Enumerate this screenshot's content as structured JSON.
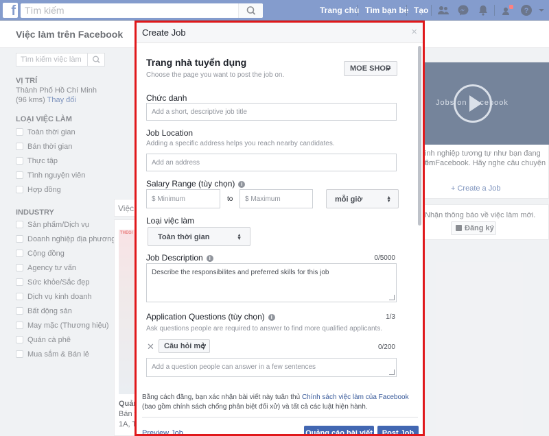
{
  "topbar": {
    "logo": "f",
    "search_placeholder": "Tìm kiếm",
    "nav": [
      "Trang chủ",
      "Tìm bạn bè",
      "Tạo"
    ],
    "icons": [
      "friends-icon",
      "messenger-icon",
      "notifications-icon",
      "menu-icon",
      "help-icon"
    ]
  },
  "subheader": {
    "title": "Việc làm trên Facebook"
  },
  "sidebar": {
    "search_placeholder": "Tìm kiếm việc làm",
    "location_heading": "VỊ TRÍ",
    "location_city": "Thành Phố Hồ Chí Minh",
    "location_radius": "(96 kms)",
    "location_change": "Thay đổi",
    "jobtype_heading": "LOẠI VIỆC LÀM",
    "jobtypes": [
      "Toàn thời gian",
      "Bán thời gian",
      "Thực tập",
      "Tình nguyện viên",
      "Hợp đồng"
    ],
    "industry_heading": "INDUSTRY",
    "industries": [
      "Sản phẩm/Dịch vụ",
      "Doanh nghiệp địa phương",
      "Cộng đồng",
      "Agency tư vấn",
      "Sức khỏe/Sắc đẹp",
      "Dịch vụ kinh doanh",
      "Bất động sản",
      "May mặc (Thương hiệu)",
      "Quán cà phê",
      "Mua sắm & Bán lẻ"
    ]
  },
  "middle": {
    "tab_label": "Việc",
    "img_text": "THEGI",
    "title": "Quảng",
    "line1": "Bán t",
    "line2": "1A, T"
  },
  "right": {
    "video_title": "Jobs on Facebook",
    "desc_line1": "inh nghiệp tương tự như bạn đang tìm",
    "desc_line2": "ên Facebook. Hãy nghe câu chuyện",
    "create_job": "+ Create a Job",
    "notify_text": "Nhận thông báo về việc làm mới.",
    "subscribe": "Đăng ký"
  },
  "dialog": {
    "title": "Create Job",
    "close": "×",
    "page_heading": "Trang nhà tuyển dụng",
    "page_hint": "Choose the page you want to post the job on.",
    "page_select": "MOE SHOP",
    "job_title_label": "Chức danh",
    "job_title_placeholder": "Add a short, descriptive job title",
    "location_label": "Job Location",
    "location_hint": "Adding a specific address helps you reach nearby candidates.",
    "location_placeholder": "Add an address",
    "salary_label": "Salary Range (tùy chọn)",
    "salary_min_placeholder": "$ Minimum",
    "salary_to": "to",
    "salary_max_placeholder": "$ Maximum",
    "salary_period": "mỗi giờ",
    "jobtype_label": "Loại việc làm",
    "jobtype_value": "Toàn thời gian",
    "desc_label": "Job Description",
    "desc_counter": "0/5000",
    "desc_placeholder": "Describe the responsibilites and preferred skills for this job",
    "questions_label": "Application Questions (tùy chọn)",
    "questions_hint": "Ask questions people are required to answer to find more qualified applicants.",
    "questions_counter": "1/3",
    "question_type": "Câu hỏi mở",
    "question_counter": "0/200",
    "question_placeholder": "Add a question people can answer in a few sentences",
    "footer_pre": "Bằng cách đăng, bạn xác nhận bài viết này tuân thủ ",
    "footer_link": "Chính sách việc làm của Facebook",
    "footer_post": " (bao gồm chính sách chống phân biệt đối xử) và tất cả các luật hiện hành.",
    "preview": "Preview Job",
    "boost": "Quảng cáo bài viết",
    "post": "Post Job"
  },
  "colors": {
    "brand": "#4267b2",
    "highlight_border": "#e0181b"
  }
}
